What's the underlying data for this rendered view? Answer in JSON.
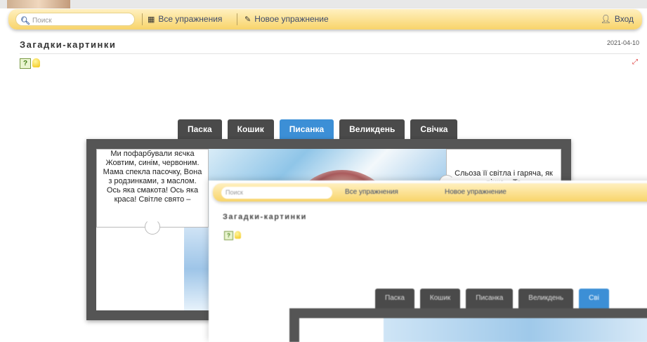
{
  "navbar": {
    "search_placeholder": "Поиск",
    "all_exercises": "Все упражнения",
    "new_exercise": "Новое упражнение",
    "login": "Вход"
  },
  "page": {
    "title": "Загадки-картинки",
    "date": "2021-04-10"
  },
  "exercise": {
    "tabs": [
      "Паска",
      "Кошик",
      "Писанка",
      "Великдень",
      "Свічка"
    ],
    "active_tab": "Писанка",
    "left_piece_text": "Ми пофарбували яєчка Жовтим, синім, червоним. Мама спекла пасочку, Вона з родзинками, з маслом. Ось яка смакота! Ось яка краса! Світле свято –",
    "right_piece_text": "Сльоза її світла і гаряча, як річка... То"
  },
  "overlay": {
    "search_placeholder": "Поиск",
    "all_exercises": "Все упражнения",
    "new_exercise": "Новое упражнение",
    "title": "Загадки-картинки",
    "tabs": [
      "Паска",
      "Кошик",
      "Писанка",
      "Великдень",
      "Сві"
    ]
  },
  "colors": {
    "navbar": "#f8d46a",
    "tab_active": "#3c8fd6",
    "tab": "#4a4a4a",
    "board": "#555555"
  }
}
